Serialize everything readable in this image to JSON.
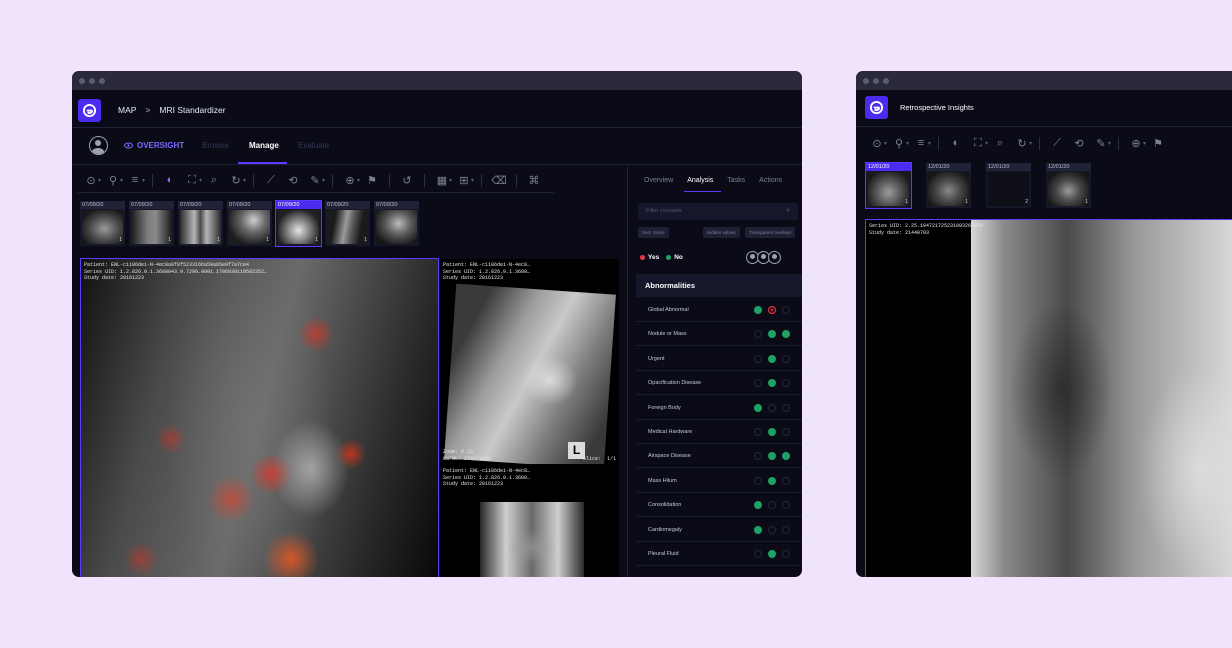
{
  "window1": {
    "breadcrumb": {
      "root": "MAP",
      "separator": ">",
      "current": "MRI Standardizer"
    },
    "nav": {
      "oversight": "OVERSIGHT",
      "tabs": [
        "Browse",
        "Manage",
        "Evaluate"
      ],
      "active_tab": "Manage"
    },
    "toolbar_icons": [
      "crosshair-icon",
      "tag-icon",
      "layers-icon",
      "contrast-icon",
      "fit-icon",
      "zoom-icon",
      "rotate-icon",
      "measure-icon",
      "refresh-icon",
      "pen-icon",
      "target-icon",
      "pin-icon",
      "undo-icon",
      "grid-icon",
      "grid-small-icon",
      "eraser-icon",
      "label-icon"
    ],
    "thumbnails": [
      {
        "date": "07/09/20",
        "count": "1"
      },
      {
        "date": "07/09/20",
        "count": "1"
      },
      {
        "date": "07/09/20",
        "count": "1"
      },
      {
        "date": "07/09/20",
        "count": "1"
      },
      {
        "date": "07/09/20",
        "count": "1",
        "selected": true
      },
      {
        "date": "07/09/20",
        "count": "1"
      },
      {
        "date": "07/09/20",
        "count": "1"
      }
    ],
    "viewport_main": {
      "patient": "Patient: ENL-c1i86dei-N-4ec8a8f8f523316ba59a65e0f7a7ce4",
      "series": "Series UID: 1.2.826.0.1.3680043.9.7296.0001.1706939119582352…",
      "study": "Study date: 20161223"
    },
    "viewport_top_right": {
      "patient": "Patient: ENL-c1i86dei-N-4ec8…",
      "series": "Series UID: 1.2.826.0.1.3680…",
      "study": "Study date: 20161223",
      "zoom": "Zoom: 0.23",
      "wwwl": "WW/WL: 2742/1028",
      "slice": "Slice:  1/1",
      "marker": "L"
    },
    "viewport_bottom_right": {
      "patient": "Patient: ENL-c1i86dei-N-4ec8…",
      "series": "Series UID: 1.2.826.0.1.3680…",
      "study": "Study date: 20161223"
    },
    "panel": {
      "tabs": [
        "Overview",
        "Analysis",
        "Tasks",
        "Actions"
      ],
      "active_tab": "Analysis",
      "filter_placeholder": "Filter concepts",
      "chips": [
        "Sort: Score",
        "Hidden values",
        "Transparent overlays"
      ],
      "yes_label": "Yes",
      "no_label": "No",
      "section_title": "Abnormalities",
      "rows": [
        {
          "label": "Global Abnormal",
          "states": [
            "g",
            "r",
            "e"
          ]
        },
        {
          "label": "Nodule or Mass",
          "states": [
            "e",
            "g",
            "g"
          ]
        },
        {
          "label": "Urgent",
          "states": [
            "e",
            "g",
            "e"
          ]
        },
        {
          "label": "Opacification Disease",
          "states": [
            "e",
            "g",
            "e"
          ]
        },
        {
          "label": "Foreign Body",
          "states": [
            "g",
            "e",
            "e"
          ]
        },
        {
          "label": "Medical Hardware",
          "states": [
            "e",
            "g",
            "e"
          ]
        },
        {
          "label": "Airspace Disease",
          "states": [
            "e",
            "g",
            "g"
          ]
        },
        {
          "label": "Mass Hilum",
          "states": [
            "e",
            "g",
            "e"
          ]
        },
        {
          "label": "Consolidation",
          "states": [
            "g",
            "e",
            "e"
          ]
        },
        {
          "label": "Cardiomegaly",
          "states": [
            "g",
            "e",
            "e"
          ]
        },
        {
          "label": "Pleural Fluid",
          "states": [
            "e",
            "g",
            "e"
          ]
        }
      ],
      "colors": {
        "yes": "#e53945",
        "no": "#1fa364"
      }
    }
  },
  "window2": {
    "title": "Retrospective Insights",
    "thumbnails": [
      {
        "date": "12/01/20",
        "count": "1",
        "selected": true
      },
      {
        "date": "12/01/20",
        "count": "1"
      },
      {
        "date": "12/01/20",
        "count": "2"
      },
      {
        "date": "12/01/20",
        "count": "1"
      }
    ],
    "viewport": {
      "series": "Series UID: 2.25.104721725231093263959",
      "study": "Study date: 21440703"
    }
  },
  "accent_color": "#4a2cf0"
}
